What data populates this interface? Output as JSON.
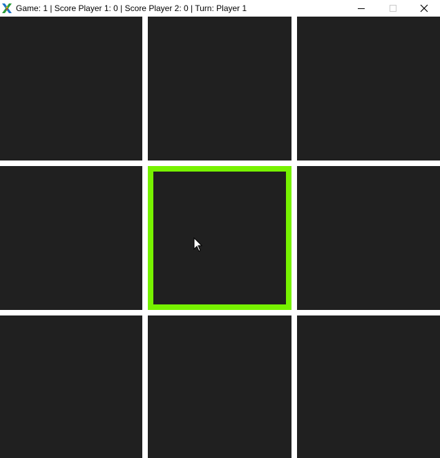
{
  "window": {
    "title": "Game: 1 | Score Player 1: 0 | Score Player 2: 0 | Turn: Player 1",
    "icon": "x-logo-icon",
    "controls": {
      "minimize_icon": "minimize-icon",
      "maximize_icon": "maximize-icon",
      "close_icon": "close-icon"
    }
  },
  "game": {
    "game_number": 1,
    "score_player_1": 0,
    "score_player_2": 0,
    "turn": "Player 1",
    "selected_cell": 4,
    "cells": [
      "",
      "",
      "",
      "",
      "",
      "",
      "",
      "",
      ""
    ]
  },
  "colors": {
    "cell_background": "#202020",
    "grid_lines": "#ffffff",
    "selection_highlight": "#77f200"
  }
}
